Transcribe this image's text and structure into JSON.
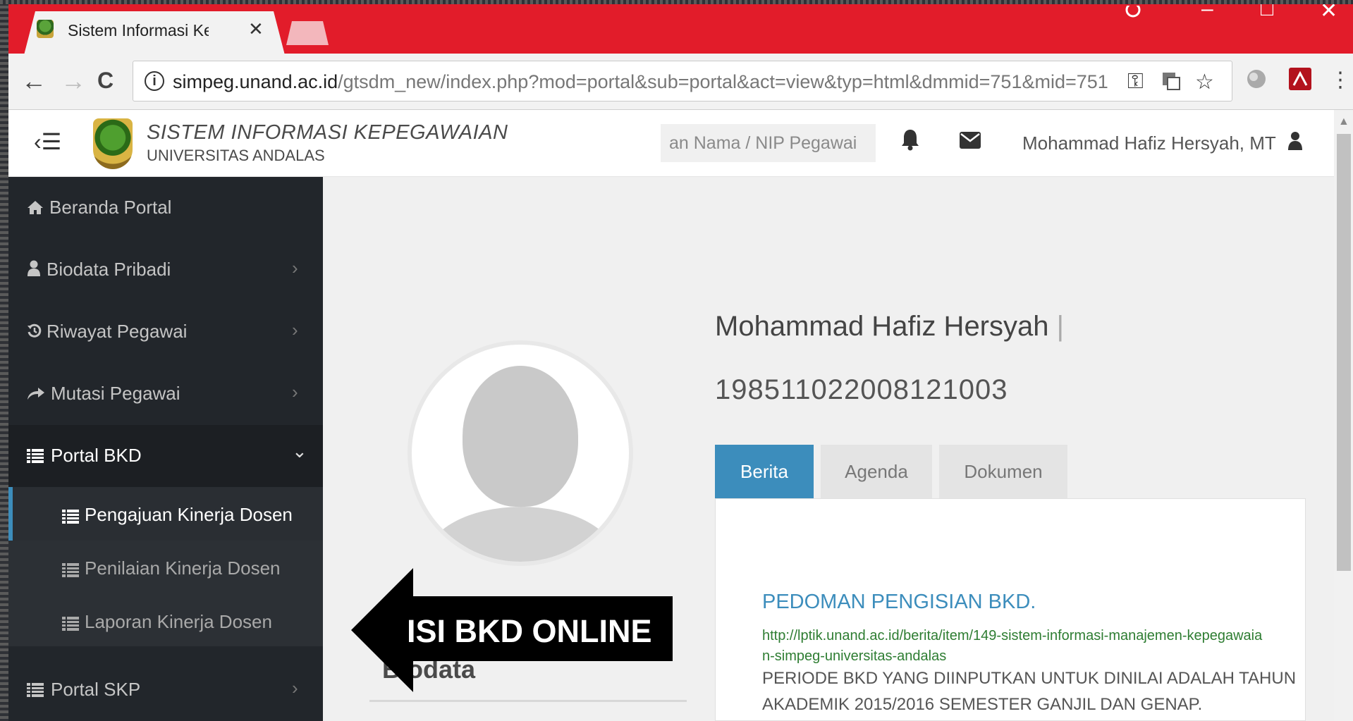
{
  "browser": {
    "tab_title": "Sistem Informasi Kepega",
    "tab_close": "✕",
    "url_host": "simpeg.unand.ac.id",
    "url_path": "/gtsdm_new/index.php?mod=portal&sub=portal&act=view&typ=html&dmmid=751&mid=751",
    "info_glyph": "i",
    "back_glyph": "←",
    "forward_glyph": "→",
    "reload_glyph": "C",
    "menu_glyph": "⋮",
    "win_min": "–",
    "win_max": "□",
    "win_close": "✕",
    "key_glyph": "⚿",
    "star_glyph": "☆"
  },
  "header": {
    "menu_toggle": "‹☰",
    "app_title": "SISTEM INFORMASI KEPEGAWAIAN",
    "app_subtitle": "UNIVERSITAS ANDALAS",
    "search_placeholder": "an Nama / NIP Pegawai",
    "user_name": "Mohammad Hafiz Hersyah, MT"
  },
  "sidebar": {
    "items": [
      {
        "label": "Beranda Portal",
        "icon": "home-icon",
        "chevron": ""
      },
      {
        "label": "Biodata Pribadi",
        "icon": "user-icon",
        "chevron": "›"
      },
      {
        "label": "Riwayat Pegawai",
        "icon": "history-icon",
        "chevron": "›"
      },
      {
        "label": "Mutasi Pegawai",
        "icon": "share-icon",
        "chevron": "›"
      },
      {
        "label": "Portal BKD",
        "icon": "list-icon",
        "chevron": "⌄"
      },
      {
        "label": "Portal SKP",
        "icon": "list-icon",
        "chevron": "›"
      }
    ],
    "subitems": [
      {
        "label": "Pengajuan Kinerja Dosen"
      },
      {
        "label": "Penilaian Kinerja Dosen"
      },
      {
        "label": "Laporan Kinerja Dosen"
      }
    ]
  },
  "profile": {
    "name": "Mohammad Hafiz Hersyah",
    "separator": "|",
    "nip": "198511022008121003",
    "biodata_title": "Biodata"
  },
  "tabs": [
    {
      "label": "Berita"
    },
    {
      "label": "Agenda"
    },
    {
      "label": "Dokumen"
    }
  ],
  "news": {
    "title": "PEDOMAN PENGISIAN BKD.",
    "link": "http://lptik.unand.ac.id/berita/item/149-sistem-informasi-manajemen-kepegawaian-simpeg-universitas-andalas",
    "text": "PERIODE BKD YANG DIINPUTKAN UNTUK DINILAI ADALAH TAHUN AKADEMIK 2015/2016 SEMESTER GANJIL DAN GENAP."
  },
  "annotation": {
    "label": "ISI BKD ONLINE"
  },
  "colors": {
    "browser_red": "#e21c2a",
    "sidebar_bg": "#22262b",
    "accent_blue": "#3c8dbc",
    "link_green": "#2e7d32"
  }
}
